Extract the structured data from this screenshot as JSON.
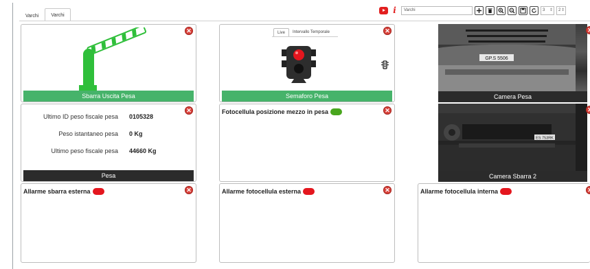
{
  "tabs": [
    {
      "label": "Varchi",
      "active": false
    },
    {
      "label": "Varchi",
      "active": true
    }
  ],
  "toolbar": {
    "search_value": "Varchi",
    "spin1_value": "3",
    "spin2_value": "2",
    "buttons": [
      "add-icon",
      "trash-icon",
      "zoom-in-icon",
      "zoom-out-icon",
      "save-icon",
      "refresh-icon"
    ]
  },
  "panels": {
    "barrier": {
      "caption": "Sbarra Uscita Pesa"
    },
    "semaphore": {
      "caption": "Semaforo Pesa",
      "subtabs": [
        "Live",
        "Intervallo Temporale"
      ]
    },
    "camera_pesa": {
      "caption": "Camera Pesa",
      "plate": "GP.S 5506"
    },
    "scale": {
      "caption": "Pesa",
      "rows": [
        {
          "label": "Ultimo ID peso fiscale pesa",
          "value": "0105328"
        },
        {
          "label": "Peso istantaneo pesa",
          "value": "0 Kg"
        },
        {
          "label": "Ultimo peso fiscale pesa",
          "value": "44660 Kg"
        }
      ]
    },
    "photocell_pos": {
      "title": "Fotocellula posizione mezzo in pesa",
      "status": "green"
    },
    "camera_sbarra": {
      "caption": "Camera Sbarra 2",
      "plate": "ES 753RK"
    },
    "alarm_barrier": {
      "title": "Allarme sbarra esterna",
      "status": "red"
    },
    "alarm_photocell_ext": {
      "title": "Allarme fotocellula esterna",
      "status": "red"
    },
    "alarm_photocell_int": {
      "title": "Allarme fotocellula interna",
      "status": "red"
    }
  },
  "colors": {
    "accent_green": "#46b36a",
    "alarm_red": "#e4161e",
    "ok_green": "#49a61e",
    "close_red": "#d9413a"
  }
}
